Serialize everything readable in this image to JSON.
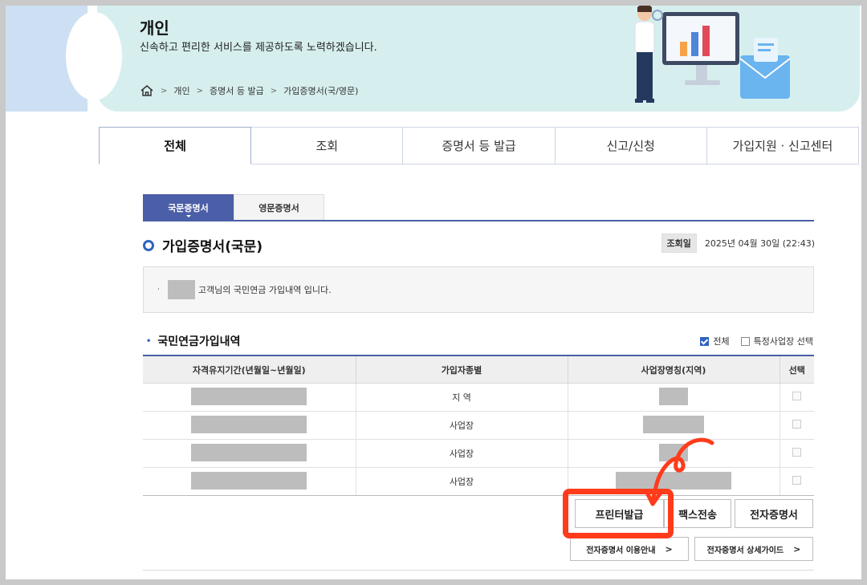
{
  "banner": {
    "title": "개인",
    "subtitle": "신속하고 편리한 서비스를 제공하도록 노력하겠습니다.",
    "breadcrumb": [
      "개인",
      "증명서 등 발급",
      "가입증명서(국/영문)"
    ]
  },
  "main_tabs": [
    "전체",
    "조회",
    "증명서 등 발급",
    "신고/신청",
    "가입지원 · 신고센터"
  ],
  "sub_tabs": [
    "국문증명서",
    "영문증명서"
  ],
  "section": {
    "title": "가입증명서(국문)",
    "date_label": "조회일",
    "date_value": "2025년 04월 30일 (22:43)"
  },
  "info": {
    "bullet": "·",
    "message": "고객님의 국민연금 가입내역 입니다."
  },
  "list": {
    "bullet": "•",
    "title": "국민연금가입내역",
    "filter_all": "전체",
    "filter_specific": "특정사업장 선택",
    "headers": [
      "자격유지기간(년월일~년월일)",
      "가입자종별",
      "사업장명칭(지역)",
      "선택"
    ],
    "rows": [
      {
        "type": "지 역"
      },
      {
        "type": "사업장"
      },
      {
        "type": "사업장"
      },
      {
        "type": "사업장"
      }
    ]
  },
  "buttons": {
    "print": "프린터발급",
    "fax": "팩스전송",
    "electronic": "전자증명서",
    "guide_use": "전자증명서 이용안내",
    "guide_detail": "전자증명서 상세가이드",
    "chevron": ">"
  },
  "colors": {
    "accent": "#4b5ea8",
    "banner_bg": "#d6efee",
    "highlight": "#ff3b1b"
  }
}
